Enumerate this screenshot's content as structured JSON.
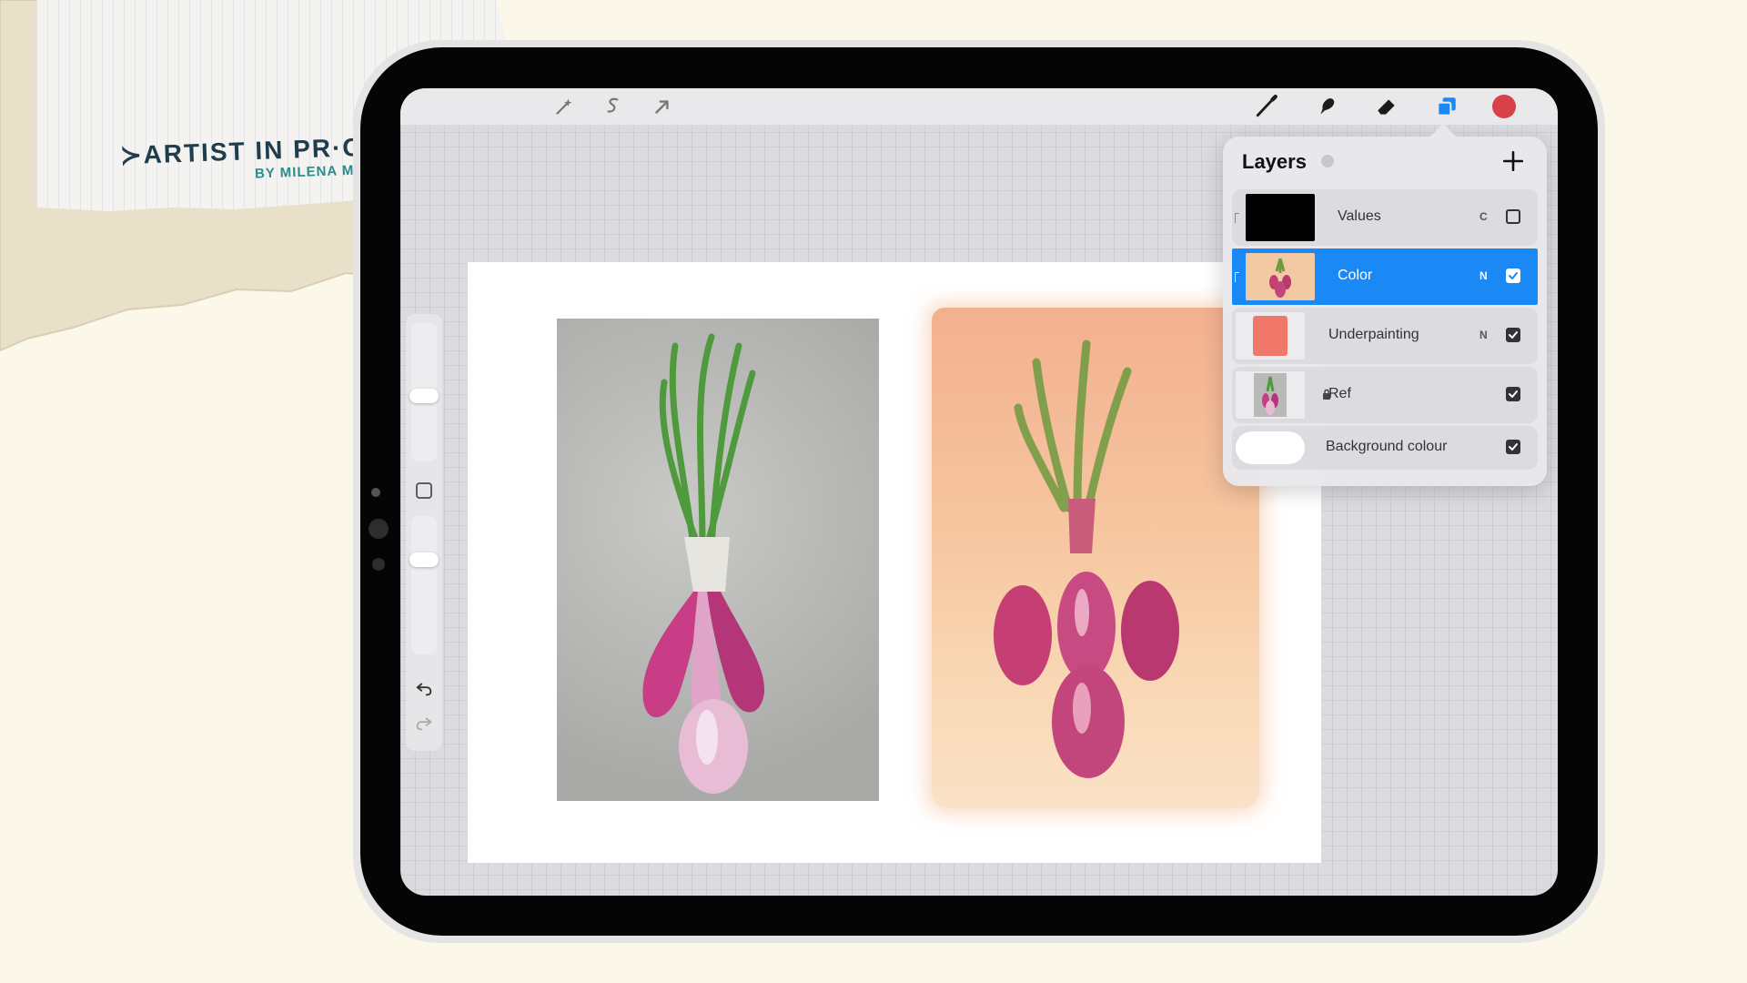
{
  "branding": {
    "title": "≻ARTIST IN PR·GRESS CLUB≺",
    "subtitle": "BY MILENA MILAK"
  },
  "toolbar": {
    "left_tools": [
      "magic-wand-icon",
      "selection-icon",
      "transform-arrow-icon"
    ],
    "right_tools": [
      "brush-icon",
      "smudge-icon",
      "eraser-icon",
      "layers-icon"
    ],
    "active_tool": "layers-icon",
    "current_color": "#d94148"
  },
  "layers_panel": {
    "title": "Layers",
    "add_label": "+",
    "layers": [
      {
        "name": "Values",
        "mode": "C",
        "visible": false,
        "active": false,
        "locked": false,
        "thumb_color": "#000000"
      },
      {
        "name": "Color",
        "mode": "N",
        "visible": true,
        "active": true,
        "locked": false,
        "thumb_color": "#f2c9a2"
      },
      {
        "name": "Underpainting",
        "mode": "N",
        "visible": true,
        "active": false,
        "locked": false,
        "thumb_color": "#f0786a"
      },
      {
        "name": "Ref",
        "mode": "",
        "visible": true,
        "active": false,
        "locked": true,
        "thumb_color": "#b9b9b7"
      }
    ],
    "background": {
      "name": "Background colour",
      "visible": true,
      "color": "#ffffff"
    }
  },
  "colors": {
    "accent": "#1a89f5",
    "page_background": "#fbf7e9"
  }
}
